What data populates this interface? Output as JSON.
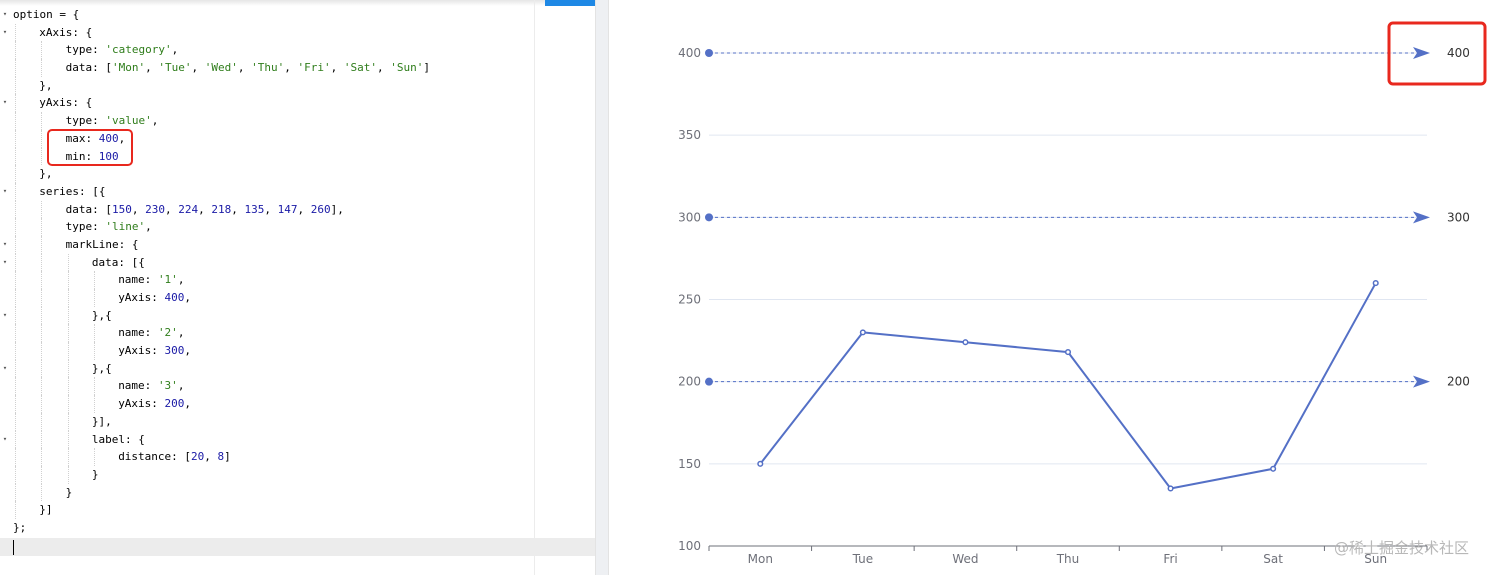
{
  "editor": {
    "lines": [
      {
        "fold": true,
        "indent": 0,
        "tokens": [
          [
            "k",
            "option = {"
          ]
        ]
      },
      {
        "fold": true,
        "indent": 1,
        "tokens": [
          [
            "k",
            "xAxis: {"
          ]
        ]
      },
      {
        "fold": false,
        "indent": 2,
        "tokens": [
          [
            "k",
            "type: "
          ],
          [
            "s",
            "'category'"
          ],
          [
            "k",
            ","
          ]
        ]
      },
      {
        "fold": false,
        "indent": 2,
        "tokens": [
          [
            "k",
            "data: ["
          ],
          [
            "s",
            "'Mon'"
          ],
          [
            "k",
            ", "
          ],
          [
            "s",
            "'Tue'"
          ],
          [
            "k",
            ", "
          ],
          [
            "s",
            "'Wed'"
          ],
          [
            "k",
            ", "
          ],
          [
            "s",
            "'Thu'"
          ],
          [
            "k",
            ", "
          ],
          [
            "s",
            "'Fri'"
          ],
          [
            "k",
            ", "
          ],
          [
            "s",
            "'Sat'"
          ],
          [
            "k",
            ", "
          ],
          [
            "s",
            "'Sun'"
          ],
          [
            "k",
            "]"
          ]
        ]
      },
      {
        "fold": false,
        "indent": 1,
        "tokens": [
          [
            "k",
            "},"
          ]
        ]
      },
      {
        "fold": true,
        "indent": 1,
        "tokens": [
          [
            "k",
            "yAxis: {"
          ]
        ]
      },
      {
        "fold": false,
        "indent": 2,
        "tokens": [
          [
            "k",
            "type: "
          ],
          [
            "s",
            "'value'"
          ],
          [
            "k",
            ","
          ]
        ]
      },
      {
        "fold": false,
        "indent": 2,
        "tokens": [
          [
            "k",
            "max: "
          ],
          [
            "n",
            "400"
          ],
          [
            "k",
            ","
          ]
        ]
      },
      {
        "fold": false,
        "indent": 2,
        "tokens": [
          [
            "k",
            "min: "
          ],
          [
            "n",
            "100"
          ]
        ]
      },
      {
        "fold": false,
        "indent": 1,
        "tokens": [
          [
            "k",
            "},"
          ]
        ]
      },
      {
        "fold": true,
        "indent": 1,
        "tokens": [
          [
            "k",
            "series: [{"
          ]
        ]
      },
      {
        "fold": false,
        "indent": 2,
        "tokens": [
          [
            "k",
            "data: ["
          ],
          [
            "n",
            "150"
          ],
          [
            "k",
            ", "
          ],
          [
            "n",
            "230"
          ],
          [
            "k",
            ", "
          ],
          [
            "n",
            "224"
          ],
          [
            "k",
            ", "
          ],
          [
            "n",
            "218"
          ],
          [
            "k",
            ", "
          ],
          [
            "n",
            "135"
          ],
          [
            "k",
            ", "
          ],
          [
            "n",
            "147"
          ],
          [
            "k",
            ", "
          ],
          [
            "n",
            "260"
          ],
          [
            "k",
            "],"
          ]
        ]
      },
      {
        "fold": false,
        "indent": 2,
        "tokens": [
          [
            "k",
            "type: "
          ],
          [
            "s",
            "'line'"
          ],
          [
            "k",
            ","
          ]
        ]
      },
      {
        "fold": true,
        "indent": 2,
        "tokens": [
          [
            "k",
            "markLine: {"
          ]
        ]
      },
      {
        "fold": true,
        "indent": 3,
        "tokens": [
          [
            "k",
            "data: [{"
          ]
        ]
      },
      {
        "fold": false,
        "indent": 4,
        "tokens": [
          [
            "k",
            "name: "
          ],
          [
            "s",
            "'1'"
          ],
          [
            "k",
            ","
          ]
        ]
      },
      {
        "fold": false,
        "indent": 4,
        "tokens": [
          [
            "k",
            "yAxis: "
          ],
          [
            "n",
            "400"
          ],
          [
            "k",
            ","
          ]
        ]
      },
      {
        "fold": true,
        "indent": 3,
        "tokens": [
          [
            "k",
            "},{"
          ]
        ]
      },
      {
        "fold": false,
        "indent": 4,
        "tokens": [
          [
            "k",
            "name: "
          ],
          [
            "s",
            "'2'"
          ],
          [
            "k",
            ","
          ]
        ]
      },
      {
        "fold": false,
        "indent": 4,
        "tokens": [
          [
            "k",
            "yAxis: "
          ],
          [
            "n",
            "300"
          ],
          [
            "k",
            ","
          ]
        ]
      },
      {
        "fold": true,
        "indent": 3,
        "tokens": [
          [
            "k",
            "},{"
          ]
        ]
      },
      {
        "fold": false,
        "indent": 4,
        "tokens": [
          [
            "k",
            "name: "
          ],
          [
            "s",
            "'3'"
          ],
          [
            "k",
            ","
          ]
        ]
      },
      {
        "fold": false,
        "indent": 4,
        "tokens": [
          [
            "k",
            "yAxis: "
          ],
          [
            "n",
            "200"
          ],
          [
            "k",
            ","
          ]
        ]
      },
      {
        "fold": false,
        "indent": 3,
        "tokens": [
          [
            "k",
            "}],"
          ]
        ]
      },
      {
        "fold": true,
        "indent": 3,
        "tokens": [
          [
            "k",
            "label: {"
          ]
        ]
      },
      {
        "fold": false,
        "indent": 4,
        "tokens": [
          [
            "k",
            "distance: ["
          ],
          [
            "n",
            "20"
          ],
          [
            "k",
            ", "
          ],
          [
            "n",
            "8"
          ],
          [
            "k",
            "]"
          ]
        ]
      },
      {
        "fold": false,
        "indent": 3,
        "tokens": [
          [
            "k",
            "}"
          ]
        ]
      },
      {
        "fold": false,
        "indent": 2,
        "tokens": [
          [
            "k",
            "}"
          ]
        ]
      },
      {
        "fold": false,
        "indent": 1,
        "tokens": [
          [
            "k",
            "}]"
          ]
        ]
      },
      {
        "fold": false,
        "indent": 0,
        "tokens": [
          [
            "k",
            "};"
          ]
        ]
      }
    ],
    "fold_icon": "chevron-down-icon",
    "colors": {
      "keyword": "#000000",
      "string": "#2f7d1b",
      "number": "#1a1aa6",
      "highlight": "#e8281e"
    }
  },
  "chart_data": {
    "type": "line",
    "categories": [
      "Mon",
      "Tue",
      "Wed",
      "Thu",
      "Fri",
      "Sat",
      "Sun"
    ],
    "series": [
      {
        "values": [
          150,
          230,
          224,
          218,
          135,
          147,
          260
        ],
        "color": "#5470c6"
      }
    ],
    "ylim": [
      100,
      400
    ],
    "yticks": [
      100,
      150,
      200,
      250,
      300,
      350,
      400
    ],
    "mark_lines": [
      {
        "name": "1",
        "value": 400,
        "label": "400"
      },
      {
        "name": "2",
        "value": 300,
        "label": "300"
      },
      {
        "name": "3",
        "value": 200,
        "label": "200"
      }
    ],
    "grid": true,
    "title": "",
    "xlabel": "",
    "ylabel": "",
    "highlight_color": "#e8281e"
  },
  "watermark": "@稀土掘金技术社区"
}
